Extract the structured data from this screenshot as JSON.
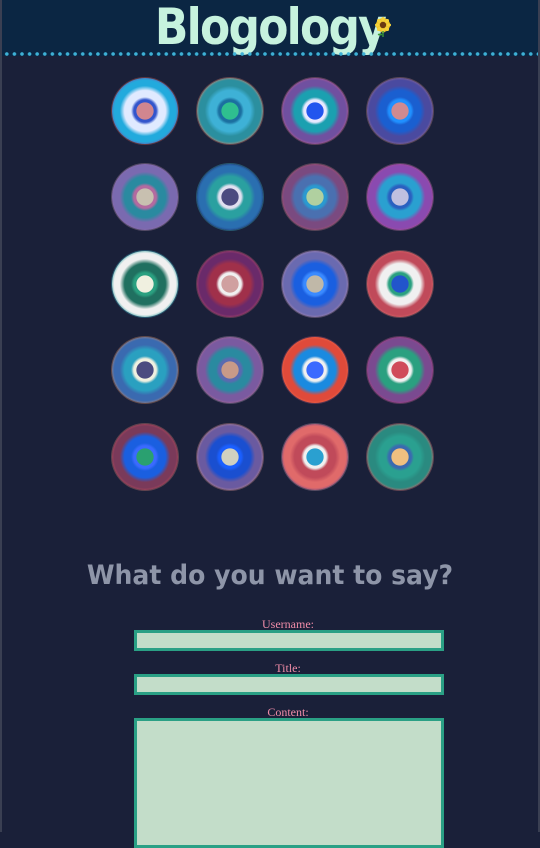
{
  "header": {
    "title": "Blogology",
    "logo_icon": "sunflower-icon",
    "bg_color": "#0b2643",
    "title_color": "#c6f2de",
    "dots_color": "#3eb1d6"
  },
  "gallery": {
    "discs": [
      {
        "center": "#d1868f",
        "rings": [
          "#3355cc",
          "#e0eaff",
          "#22aadd",
          "#7755aa",
          "#ee6655"
        ]
      },
      {
        "center": "#2fbf8f",
        "rings": [
          "#1b6fa0",
          "#3eb1d6",
          "#2b8f9f",
          "#e68a6a",
          "#f08a70"
        ]
      },
      {
        "center": "#2255ee",
        "rings": [
          "#e8e8ff",
          "#1ba0b0",
          "#7050a0",
          "#c05a90",
          "#e080a0"
        ]
      },
      {
        "center": "#d08a90",
        "rings": [
          "#2090ff",
          "#1a5fd0",
          "#4a4aa0",
          "#a07090",
          "#d09090"
        ]
      },
      {
        "center": "#c8c0b0",
        "rings": [
          "#b36aa0",
          "#2a8aa0",
          "#7a6ab0",
          "#8e6aa8",
          "#c8a0c0"
        ]
      },
      {
        "center": "#4b4b80",
        "rings": [
          "#e0e0f0",
          "#2aa0a0",
          "#2a6fb0",
          "#223a80",
          "#3ec4dc"
        ]
      },
      {
        "center": "#b0d0a0",
        "rings": [
          "#2a9ad0",
          "#4a70b0",
          "#7a4a80",
          "#b0506a",
          "#d08a90"
        ]
      },
      {
        "center": "#c0c0e0",
        "rings": [
          "#2a60c0",
          "#2aa0d0",
          "#8a4ab0",
          "#b04a90",
          "#d080b0"
        ]
      },
      {
        "center": "#f0f0e0",
        "rings": [
          "#2aa080",
          "#207060",
          "#f0f0f0",
          "#2aa0a0",
          "#3ec4dc"
        ]
      },
      {
        "center": "#d0a0a0",
        "rings": [
          "#f0f0f0",
          "#a0304a",
          "#6a2a6a",
          "#c04a6a",
          "#e06a80"
        ]
      },
      {
        "center": "#c0b8a8",
        "rings": [
          "#3a8aff",
          "#1a5fe0",
          "#6a6ab0",
          "#b08ab0",
          "#d0a8d0"
        ]
      },
      {
        "center": "#2255cc",
        "rings": [
          "#2aa080",
          "#f0f0f0",
          "#c04a5a",
          "#e06a6a",
          "#f08a7a"
        ]
      },
      {
        "center": "#4a4a80",
        "rings": [
          "#f0f0e0",
          "#2aa0c0",
          "#3a6ab0",
          "#c08a70",
          "#f0a070"
        ]
      },
      {
        "center": "#c89a88",
        "rings": [
          "#5a6ab0",
          "#2a8aa0",
          "#7a5aa0",
          "#b06a90",
          "#c0a0c0"
        ]
      },
      {
        "center": "#3a6aff",
        "rings": [
          "#f0f0f0",
          "#1a8ae0",
          "#e04a3a",
          "#f06a4a",
          "#d05a7a"
        ]
      },
      {
        "center": "#d04a5a",
        "rings": [
          "#f0f0f0",
          "#2aa080",
          "#7a4a90",
          "#b03a80",
          "#d06aa0"
        ]
      },
      {
        "center": "#2aa070",
        "rings": [
          "#3a6aff",
          "#1a5fe0",
          "#7a3a5a",
          "#c04a5a",
          "#f08a7a"
        ]
      },
      {
        "center": "#d0d0c0",
        "rings": [
          "#1a5fff",
          "#1a4fd0",
          "#6a5aa0",
          "#c08a90",
          "#f0a0a0"
        ]
      },
      {
        "center": "#2aa0d0",
        "rings": [
          "#f0f0f0",
          "#c04a5a",
          "#e06a6a",
          "#6a4a8a",
          "#d0a0b0"
        ]
      },
      {
        "center": "#f0c080",
        "rings": [
          "#3a6ab0",
          "#2aa090",
          "#2a8a80",
          "#e06a6a",
          "#f08a80"
        ]
      }
    ]
  },
  "form": {
    "heading": "What do you want to say?",
    "username_label": "Username:",
    "username_value": "",
    "username_placeholder": "",
    "title_label": "Title:",
    "title_value": "",
    "title_placeholder": "",
    "content_label": "Content:",
    "content_value": "",
    "content_placeholder": "",
    "label_color": "#f08ca8",
    "field_color": "#c3ddc9",
    "field_border": "#2aa085"
  }
}
